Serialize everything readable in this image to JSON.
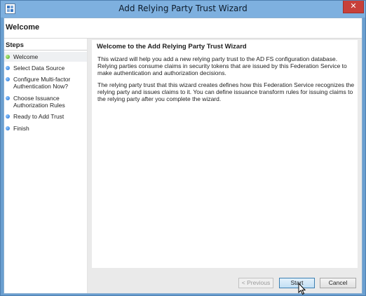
{
  "window": {
    "title": "Add Relying Party Trust Wizard",
    "close_label": "✕"
  },
  "header": {
    "title": "Welcome"
  },
  "steps": {
    "heading": "Steps",
    "items": [
      {
        "label": "Welcome",
        "status": "current",
        "status_color": "#4aa21c"
      },
      {
        "label": "Select Data Source",
        "status": "pending",
        "status_color": "#1f6fd1"
      },
      {
        "label": "Configure Multi-factor Authentication Now?",
        "status": "pending",
        "status_color": "#1f6fd1"
      },
      {
        "label": "Choose Issuance Authorization Rules",
        "status": "pending",
        "status_color": "#1f6fd1"
      },
      {
        "label": "Ready to Add Trust",
        "status": "pending",
        "status_color": "#1f6fd1"
      },
      {
        "label": "Finish",
        "status": "pending",
        "status_color": "#1f6fd1"
      }
    ]
  },
  "content": {
    "title": "Welcome to the Add Relying Party Trust Wizard",
    "paragraph1": "This wizard will help you add a new relying party trust to the AD FS configuration database.  Relying parties consume claims in security tokens that are issued by this Federation Service to make authentication and authorization decisions.",
    "paragraph2": "The relying party trust that this wizard creates defines how this Federation Service recognizes the relying party and issues claims to it. You can define issuance transform rules for issuing claims to the relying party after you complete the wizard."
  },
  "footer": {
    "previous_label": "< Previous",
    "start_label": "Start",
    "cancel_label": "Cancel"
  },
  "colors": {
    "titlebar": "#7eb0df",
    "close": "#c7403a",
    "primary_button": "#c2dff4"
  }
}
